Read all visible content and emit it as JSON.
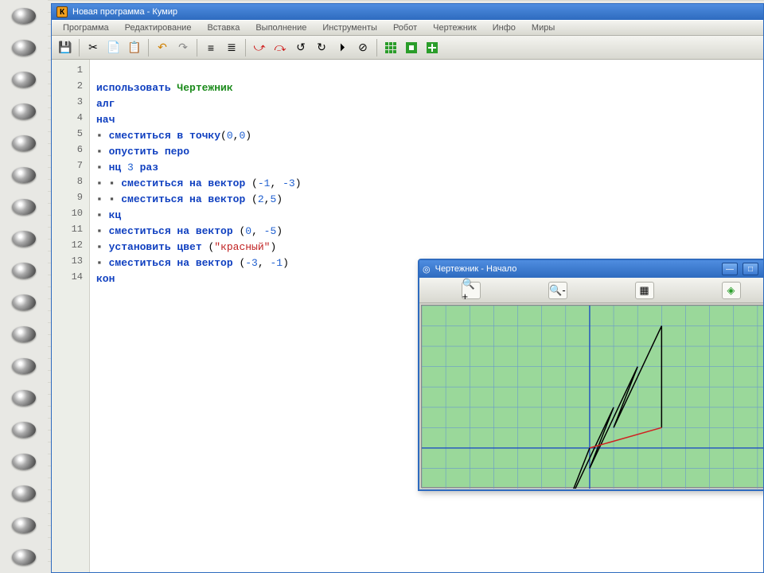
{
  "app": {
    "icon_letter": "К",
    "title": "Новая программа - Кумир"
  },
  "menu": {
    "items": [
      "Программа",
      "Редактирование",
      "Вставка",
      "Выполнение",
      "Инструменты",
      "Робот",
      "Чертежник",
      "Инфо",
      "Миры"
    ]
  },
  "line_count": 14,
  "source": {
    "l1_kw": "использовать ",
    "l1_perf": "Чертежник",
    "l2": "алг",
    "l3": "нач",
    "l4_a": "сместиться в точку",
    "l4_n1": "0",
    "l4_n2": "0",
    "l5": "опустить перо",
    "l6_a": "нц ",
    "l6_n": "3",
    "l6_b": " раз",
    "l7_a": "сместиться на вектор ",
    "l7_n1": "-1",
    "l7_n2": "-3",
    "l8_a": "сместиться на вектор ",
    "l8_n1": "2",
    "l8_n2": "5",
    "l9": "кц",
    "l10_a": "сместиться на вектор ",
    "l10_n1": "0",
    "l10_n2": "-5",
    "l11_a": "установить цвет ",
    "l11_s": "\"красный\"",
    "l12_a": "сместиться на вектор ",
    "l12_n1": "-3",
    "l12_n2": "-1",
    "l13": "кон"
  },
  "child": {
    "title": "Чертежник - Начало"
  },
  "chart_data": {
    "type": "line",
    "title": "Чертежник - Начало",
    "xlabel": "",
    "ylabel": "",
    "xlim": [
      -7,
      8
    ],
    "ylim": [
      -2,
      7
    ],
    "grid": true,
    "background": "#9ad89a",
    "series": [
      {
        "name": "pen-black",
        "color": "#000000",
        "points": [
          [
            0,
            0
          ],
          [
            -1,
            -3
          ],
          [
            1,
            2
          ],
          [
            0,
            -1
          ],
          [
            2,
            4
          ],
          [
            1,
            1
          ],
          [
            3,
            6
          ],
          [
            3,
            1
          ]
        ]
      },
      {
        "name": "pen-red",
        "color": "#d02020",
        "points": [
          [
            3,
            1
          ],
          [
            0,
            0
          ]
        ]
      }
    ]
  }
}
